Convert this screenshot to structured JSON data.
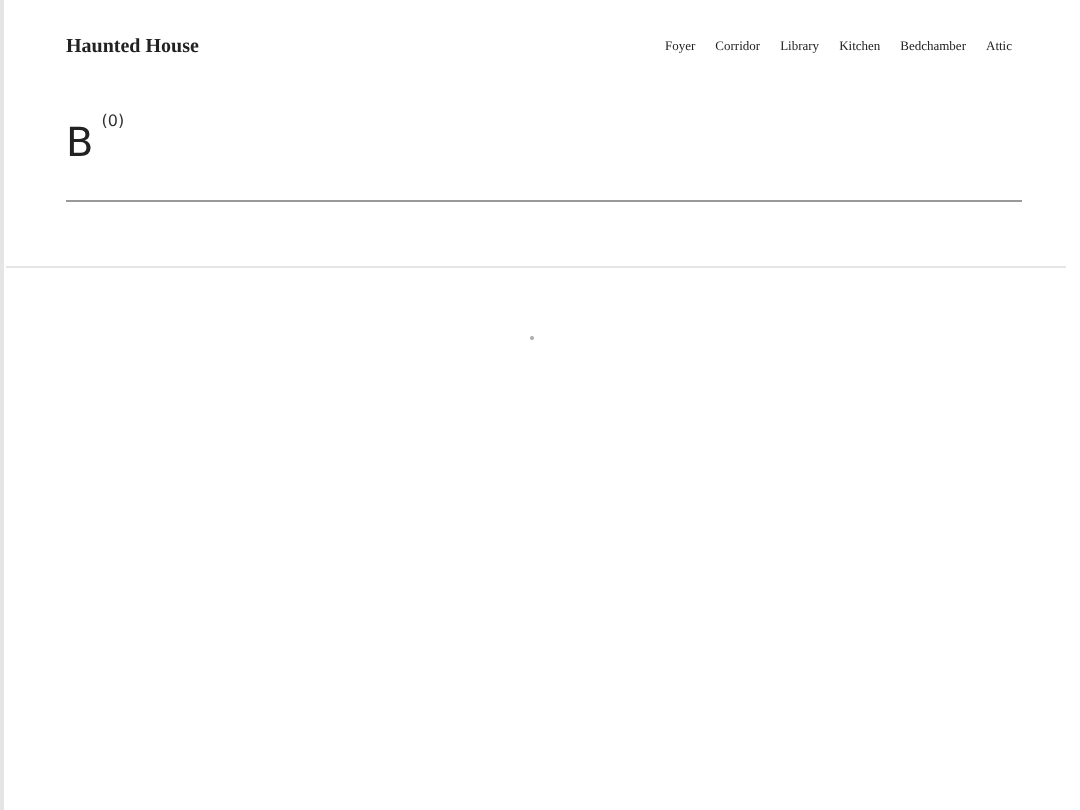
{
  "site_title": "Haunted House",
  "nav": [
    {
      "label": "Foyer"
    },
    {
      "label": "Corridor"
    },
    {
      "label": "Library"
    },
    {
      "label": "Kitchen"
    },
    {
      "label": "Bedchamber"
    },
    {
      "label": "Attic"
    }
  ],
  "heading": {
    "title": "B",
    "count": "(0)"
  }
}
